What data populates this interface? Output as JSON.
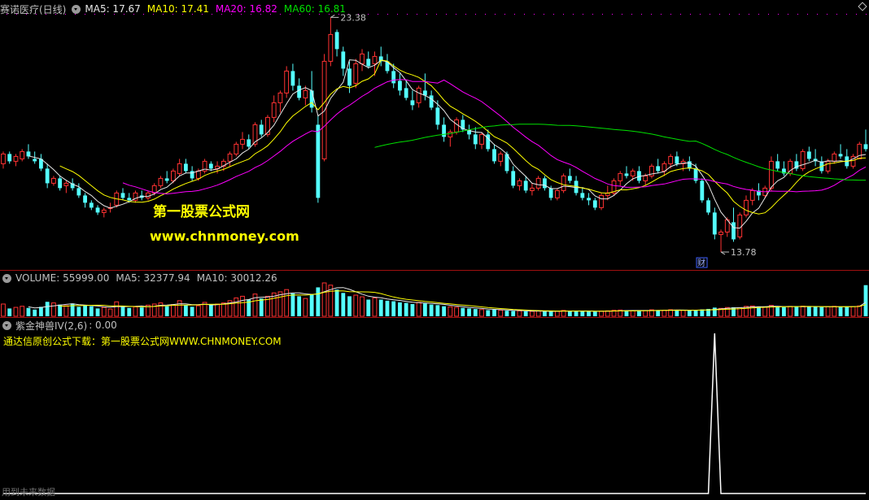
{
  "price_header": {
    "stock": "赛诺医疗(日线)",
    "ma5": "MA5: 17.67",
    "ma10": "MA10: 17.41",
    "ma20": "MA20: 16.82",
    "ma60": "MA60: 16.81"
  },
  "volume_header": {
    "volume": "VOLUME: 55999.00",
    "ma5": "MA5: 32377.94",
    "ma10": "MA10: 30012.26"
  },
  "indicator_header": {
    "name": "紫金神兽IV(2,6)",
    "value": ": 0.00"
  },
  "indicator_note": "通达信原创公式下载：第一股票公式网WWW.CHNMONEY.COM",
  "watermark": {
    "line1": "第一股票公式网",
    "line2": "www.chnmoney.com"
  },
  "annotations": {
    "high_label": "23.38",
    "low_label": "13.78",
    "finance_badge": "财"
  },
  "footer": "用到未来数据",
  "colors": {
    "up": "#ff3232",
    "down": "#54ffff",
    "ma5": "#e8e8e8",
    "ma10": "#ffff00",
    "ma20": "#ff00ff",
    "ma60": "#00e000",
    "panel_border": "#a01010",
    "indicator_line": "#ffffff"
  },
  "chart_data": {
    "type": "candlestick",
    "candles_ohlc": [
      [
        17.4,
        17.9,
        17.2,
        17.8
      ],
      [
        17.8,
        17.9,
        17.4,
        17.5
      ],
      [
        17.5,
        17.8,
        17.3,
        17.7
      ],
      [
        17.6,
        18.0,
        17.5,
        17.9
      ],
      [
        17.9,
        18.2,
        17.6,
        17.7
      ],
      [
        17.6,
        17.9,
        17.4,
        17.5
      ],
      [
        17.6,
        17.8,
        17.1,
        17.2
      ],
      [
        17.2,
        17.4,
        16.4,
        16.6
      ],
      [
        16.6,
        16.9,
        16.5,
        16.8
      ],
      [
        16.8,
        16.9,
        16.3,
        16.4
      ],
      [
        16.5,
        16.7,
        16.2,
        16.6
      ],
      [
        16.6,
        16.8,
        16.3,
        16.4
      ],
      [
        16.4,
        16.6,
        16.0,
        16.1
      ],
      [
        16.1,
        16.2,
        15.6,
        15.8
      ],
      [
        15.8,
        15.9,
        15.5,
        15.6
      ],
      [
        15.6,
        15.7,
        15.3,
        15.4
      ],
      [
        15.4,
        15.6,
        15.2,
        15.5
      ],
      [
        15.6,
        15.8,
        15.4,
        15.6
      ],
      [
        15.7,
        16.3,
        15.6,
        16.2
      ],
      [
        16.2,
        16.4,
        15.9,
        16.0
      ],
      [
        16.0,
        16.2,
        15.8,
        15.9
      ],
      [
        15.9,
        16.3,
        15.8,
        16.2
      ],
      [
        16.1,
        16.3,
        15.9,
        16.0
      ],
      [
        16.0,
        16.3,
        15.9,
        16.2
      ],
      [
        16.2,
        16.6,
        16.1,
        16.5
      ],
      [
        16.5,
        16.9,
        16.4,
        16.8
      ],
      [
        16.8,
        17.1,
        16.6,
        16.7
      ],
      [
        16.7,
        17.2,
        16.6,
        17.1
      ],
      [
        17.0,
        17.6,
        16.9,
        17.4
      ],
      [
        17.4,
        17.6,
        17.0,
        17.1
      ],
      [
        17.1,
        17.3,
        16.7,
        16.8
      ],
      [
        16.8,
        17.2,
        16.7,
        17.1
      ],
      [
        17.1,
        17.6,
        17.0,
        17.5
      ],
      [
        17.4,
        17.5,
        17.1,
        17.2
      ],
      [
        17.2,
        17.5,
        17.0,
        17.3
      ],
      [
        17.3,
        17.6,
        17.1,
        17.5
      ],
      [
        17.5,
        17.9,
        17.3,
        17.8
      ],
      [
        17.8,
        18.3,
        17.7,
        18.2
      ],
      [
        18.2,
        18.7,
        18.0,
        18.4
      ],
      [
        18.4,
        18.6,
        18.0,
        18.1
      ],
      [
        18.2,
        19.1,
        18.1,
        19.0
      ],
      [
        19.0,
        19.2,
        18.5,
        18.6
      ],
      [
        18.6,
        19.4,
        18.5,
        19.3
      ],
      [
        19.3,
        20.2,
        19.1,
        19.9
      ],
      [
        19.9,
        20.4,
        19.5,
        20.3
      ],
      [
        20.3,
        21.4,
        20.1,
        21.2
      ],
      [
        21.2,
        21.5,
        20.4,
        20.6
      ],
      [
        20.6,
        20.9,
        20.0,
        20.1
      ],
      [
        20.1,
        20.6,
        19.8,
        20.4
      ],
      [
        20.4,
        21.2,
        19.5,
        19.7
      ],
      [
        19.0,
        19.4,
        15.8,
        16.0
      ],
      [
        17.6,
        21.9,
        17.5,
        21.6
      ],
      [
        21.6,
        23.4,
        21.4,
        22.7
      ],
      [
        22.8,
        22.9,
        21.8,
        22.1
      ],
      [
        22.0,
        22.2,
        21.0,
        21.3
      ],
      [
        21.3,
        21.6,
        20.3,
        20.6
      ],
      [
        20.7,
        21.7,
        20.5,
        21.5
      ],
      [
        21.5,
        22.1,
        21.2,
        21.9
      ],
      [
        21.7,
        22.0,
        21.3,
        21.4
      ],
      [
        21.5,
        22.0,
        21.0,
        21.8
      ],
      [
        21.8,
        22.2,
        21.4,
        21.6
      ],
      [
        21.6,
        21.9,
        21.1,
        21.2
      ],
      [
        21.2,
        21.5,
        20.5,
        20.7
      ],
      [
        20.8,
        21.1,
        20.2,
        20.4
      ],
      [
        20.5,
        20.8,
        20.0,
        20.1
      ],
      [
        20.0,
        20.4,
        19.6,
        19.8
      ],
      [
        19.9,
        20.6,
        19.7,
        20.5
      ],
      [
        20.4,
        21.1,
        20.0,
        20.2
      ],
      [
        20.2,
        20.4,
        19.6,
        19.7
      ],
      [
        19.7,
        20.0,
        18.8,
        19.0
      ],
      [
        19.0,
        19.3,
        18.3,
        18.5
      ],
      [
        18.5,
        18.8,
        18.1,
        18.7
      ],
      [
        18.7,
        19.3,
        18.6,
        19.2
      ],
      [
        19.2,
        19.4,
        18.7,
        18.8
      ],
      [
        18.8,
        19.0,
        18.4,
        18.6
      ],
      [
        18.6,
        18.9,
        18.0,
        18.2
      ],
      [
        18.2,
        18.7,
        18.0,
        18.6
      ],
      [
        18.6,
        18.8,
        17.9,
        18.0
      ],
      [
        18.0,
        18.2,
        17.4,
        17.5
      ],
      [
        17.5,
        17.9,
        17.3,
        17.8
      ],
      [
        17.8,
        17.9,
        17.0,
        17.1
      ],
      [
        17.1,
        17.3,
        16.4,
        16.5
      ],
      [
        16.5,
        16.8,
        16.3,
        16.7
      ],
      [
        16.7,
        16.9,
        16.2,
        16.3
      ],
      [
        16.3,
        16.6,
        16.1,
        16.4
      ],
      [
        16.4,
        16.9,
        16.3,
        16.8
      ],
      [
        16.8,
        16.9,
        16.3,
        16.4
      ],
      [
        16.4,
        16.5,
        15.9,
        16.0
      ],
      [
        16.0,
        16.4,
        15.9,
        16.3
      ],
      [
        16.3,
        17.0,
        16.2,
        16.9
      ],
      [
        16.9,
        17.2,
        16.6,
        16.7
      ],
      [
        16.7,
        16.9,
        16.1,
        16.2
      ],
      [
        16.2,
        16.4,
        15.9,
        16.0
      ],
      [
        16.0,
        16.2,
        15.7,
        15.9
      ],
      [
        15.9,
        16.0,
        15.5,
        15.6
      ],
      [
        15.6,
        16.2,
        15.5,
        16.1
      ],
      [
        16.1,
        16.5,
        15.9,
        16.2
      ],
      [
        16.2,
        16.8,
        16.1,
        16.7
      ],
      [
        16.7,
        17.1,
        16.5,
        17.0
      ],
      [
        17.0,
        17.3,
        16.8,
        16.9
      ],
      [
        16.9,
        17.2,
        16.7,
        17.1
      ],
      [
        17.1,
        17.3,
        16.6,
        16.7
      ],
      [
        16.7,
        17.0,
        16.5,
        16.9
      ],
      [
        16.9,
        17.4,
        16.8,
        17.3
      ],
      [
        17.3,
        17.6,
        17.0,
        17.1
      ],
      [
        17.1,
        17.5,
        16.9,
        17.4
      ],
      [
        17.4,
        17.8,
        17.2,
        17.7
      ],
      [
        17.7,
        17.9,
        17.3,
        17.4
      ],
      [
        17.4,
        17.6,
        17.1,
        17.5
      ],
      [
        17.5,
        17.7,
        17.1,
        17.2
      ],
      [
        17.2,
        17.4,
        16.6,
        16.7
      ],
      [
        16.7,
        16.8,
        15.8,
        15.9
      ],
      [
        15.9,
        16.0,
        15.3,
        15.4
      ],
      [
        15.4,
        15.6,
        14.3,
        14.5
      ],
      [
        14.5,
        14.7,
        13.78,
        14.6
      ],
      [
        14.6,
        15.2,
        14.4,
        15.1
      ],
      [
        15.0,
        15.6,
        14.2,
        14.3
      ],
      [
        14.4,
        15.4,
        14.3,
        15.3
      ],
      [
        15.3,
        16.1,
        15.2,
        15.9
      ],
      [
        15.9,
        16.4,
        15.7,
        16.3
      ],
      [
        16.3,
        16.6,
        15.9,
        16.1
      ],
      [
        16.1,
        16.5,
        16.0,
        16.4
      ],
      [
        16.4,
        17.7,
        16.3,
        17.5
      ],
      [
        17.5,
        17.8,
        17.1,
        17.2
      ],
      [
        17.2,
        17.5,
        16.9,
        17.0
      ],
      [
        17.0,
        17.6,
        16.9,
        17.5
      ],
      [
        17.5,
        17.8,
        17.1,
        17.2
      ],
      [
        17.2,
        18.0,
        17.1,
        17.9
      ],
      [
        17.9,
        18.1,
        17.5,
        17.6
      ],
      [
        17.6,
        18.0,
        17.3,
        17.5
      ],
      [
        17.5,
        17.7,
        17.0,
        17.1
      ],
      [
        17.1,
        17.6,
        17.0,
        17.5
      ],
      [
        17.5,
        17.9,
        17.4,
        17.8
      ],
      [
        17.8,
        18.2,
        17.6,
        17.7
      ],
      [
        17.7,
        18.0,
        17.2,
        17.3
      ],
      [
        17.3,
        17.8,
        17.2,
        17.7
      ],
      [
        17.6,
        18.3,
        17.6,
        18.2
      ],
      [
        18.2,
        18.8,
        17.9,
        18.0
      ]
    ],
    "volume": [
      22000,
      14000,
      16000,
      18000,
      15000,
      12000,
      17000,
      26000,
      24000,
      21000,
      19000,
      23000,
      17000,
      20000,
      18000,
      14000,
      16000,
      13000,
      26000,
      18000,
      15000,
      17000,
      16000,
      20000,
      22000,
      24000,
      18000,
      21000,
      28000,
      20000,
      17000,
      19000,
      25000,
      21000,
      22000,
      24000,
      28000,
      33000,
      36000,
      30000,
      40000,
      32000,
      36000,
      42000,
      44000,
      48000,
      41000,
      36000,
      32000,
      40000,
      52000,
      60000,
      56000,
      48000,
      42000,
      36000,
      38000,
      35000,
      30000,
      33000,
      30000,
      28000,
      27000,
      25000,
      24000,
      22000,
      25000,
      23000,
      21000,
      20000,
      18000,
      17000,
      16000,
      15000,
      14000,
      13000,
      12000,
      11000,
      12000,
      11000,
      10000,
      9500,
      9800,
      9000,
      8800,
      9500,
      9000,
      8600,
      9100,
      10500,
      9800,
      9400,
      9000,
      8700,
      8400,
      9300,
      9800,
      10800,
      11200,
      10400,
      10100,
      9800,
      10300,
      11600,
      10600,
      10900,
      11800,
      11200,
      10800,
      10400,
      10600,
      12400,
      13200,
      15600,
      14200,
      15800,
      16200,
      15400,
      17800,
      18600,
      17400,
      16800,
      19600,
      17200,
      16400,
      17800,
      16900,
      18200,
      17600,
      17100,
      16500,
      17300,
      17900,
      17500,
      16800,
      17400,
      18600,
      55999
    ],
    "ma_values": {
      "MA5": 17.67,
      "MA10": 17.41,
      "MA20": 16.82,
      "MA60": 16.81
    },
    "indicator": {
      "name": "紫金神兽IV(2,6)",
      "value": 0.0,
      "spike_bar_index": 113
    },
    "high": 23.38,
    "low": 13.78
  }
}
